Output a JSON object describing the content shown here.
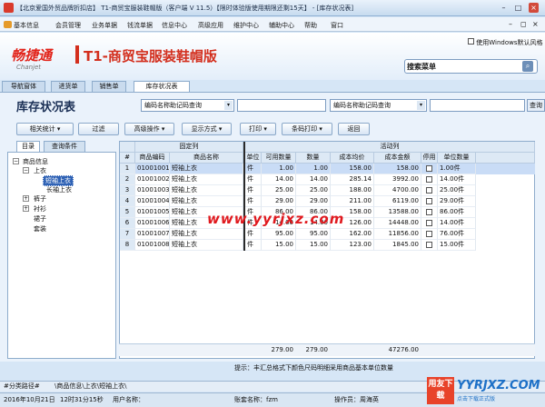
{
  "window": {
    "title": "【北京爱国外贸品牌折扣店】 T1-商贸宝服装鞋帽版（客户端 V 11.5）【限时体验版使用期限还剩15天】 - [库存状况表]"
  },
  "menu": [
    "基本信息",
    "会员管理",
    "业务单据",
    "钱流单据",
    "信息中心",
    "高级应用",
    "维护中心",
    "辅助中心",
    "帮助",
    "窗口"
  ],
  "banner": {
    "logo_cn": "畅捷通",
    "logo_en": "Chanjet",
    "product": "T1-商贸宝服装鞋帽版",
    "winfont_label": "使用Windows默认风格",
    "search_label": "搜索菜单"
  },
  "tabs": [
    "导航窗体",
    "进货单",
    "销售单",
    "库存状况表"
  ],
  "page": {
    "title": "库存状况表",
    "filter1": "编码名称助记码查询",
    "filter2": "编码名称助记码查询",
    "query_btn": "查询"
  },
  "toolbar": [
    "相关统计",
    "过滤",
    "高级操作",
    "显示方式",
    "打印",
    "条码打印",
    "返回"
  ],
  "left_tabs": [
    "目录",
    "查询条件"
  ],
  "tree": {
    "root": "商品信息",
    "n_top": "上衣",
    "n_short": "短袖上衣",
    "n_long": "长袖上衣",
    "n_pants": "裤子",
    "n_shirt": "衬衫",
    "n_skirt": "裙子",
    "n_suit": "套装"
  },
  "grid": {
    "group_fixed": "固定列",
    "group_active": "活动列",
    "headers": [
      "商品编码",
      "商品名称",
      "单位",
      "可用数量",
      "数量",
      "成本均价",
      "成本金额",
      "停用",
      "单位数量"
    ],
    "rows": [
      {
        "no": "1",
        "code": "01001001",
        "name": "短袖上衣",
        "unit": "件",
        "avail": "1.00",
        "qty": "1.00",
        "avg": "158.00",
        "amount": "158.00",
        "unitqty": "1.00件"
      },
      {
        "no": "2",
        "code": "01001002",
        "name": "短袖上衣",
        "unit": "件",
        "avail": "14.00",
        "qty": "14.00",
        "avg": "285.14",
        "amount": "3992.00",
        "unitqty": "14.00件"
      },
      {
        "no": "3",
        "code": "01001003",
        "name": "短袖上衣",
        "unit": "件",
        "avail": "25.00",
        "qty": "25.00",
        "avg": "188.00",
        "amount": "4700.00",
        "unitqty": "25.00件"
      },
      {
        "no": "4",
        "code": "01001004",
        "name": "短袖上衣",
        "unit": "件",
        "avail": "29.00",
        "qty": "29.00",
        "avg": "211.00",
        "amount": "6119.00",
        "unitqty": "29.00件"
      },
      {
        "no": "5",
        "code": "01001005",
        "name": "短袖上衣",
        "unit": "件",
        "avail": "86.00",
        "qty": "86.00",
        "avg": "158.00",
        "amount": "13588.00",
        "unitqty": "86.00件"
      },
      {
        "no": "6",
        "code": "01001006",
        "name": "短袖上衣",
        "unit": "件",
        "avail": "14.00",
        "qty": "14.00",
        "avg": "126.00",
        "amount": "14448.00",
        "unitqty": "14.00件"
      },
      {
        "no": "7",
        "code": "01001007",
        "name": "短袖上衣",
        "unit": "件",
        "avail": "95.00",
        "qty": "95.00",
        "avg": "162.00",
        "amount": "11856.00",
        "unitqty": "76.00件"
      },
      {
        "no": "8",
        "code": "01001008",
        "name": "短袖上衣",
        "unit": "件",
        "avail": "15.00",
        "qty": "15.00",
        "avg": "123.00",
        "amount": "1845.00",
        "unitqty": "15.00件"
      }
    ],
    "total_avail": "279.00",
    "total_qty": "279.00",
    "total_amount": "47276.00"
  },
  "tip": "提示：丰汇总格式下颜色尺码明细采用商品基本单位数量",
  "pathbar": {
    "left": "#分类路径#",
    "path": "\\商品信息\\上衣\\短袖上衣\\"
  },
  "status": {
    "date": "2016年10月21日",
    "time": "12时31分15秒",
    "user_label": "用户名称：",
    "ledger": "账套名称：fzm",
    "operator": "操作员：周海英"
  },
  "watermark": {
    "center": "www.yyrjxz.com",
    "badge": "用友下载",
    "site": "YYRJXZ.COM",
    "sub": "点击下载正式版"
  },
  "colors": {
    "accent": "#1a2f55",
    "brand_red": "#e2231a",
    "selected_row": "#c9dcf6"
  }
}
